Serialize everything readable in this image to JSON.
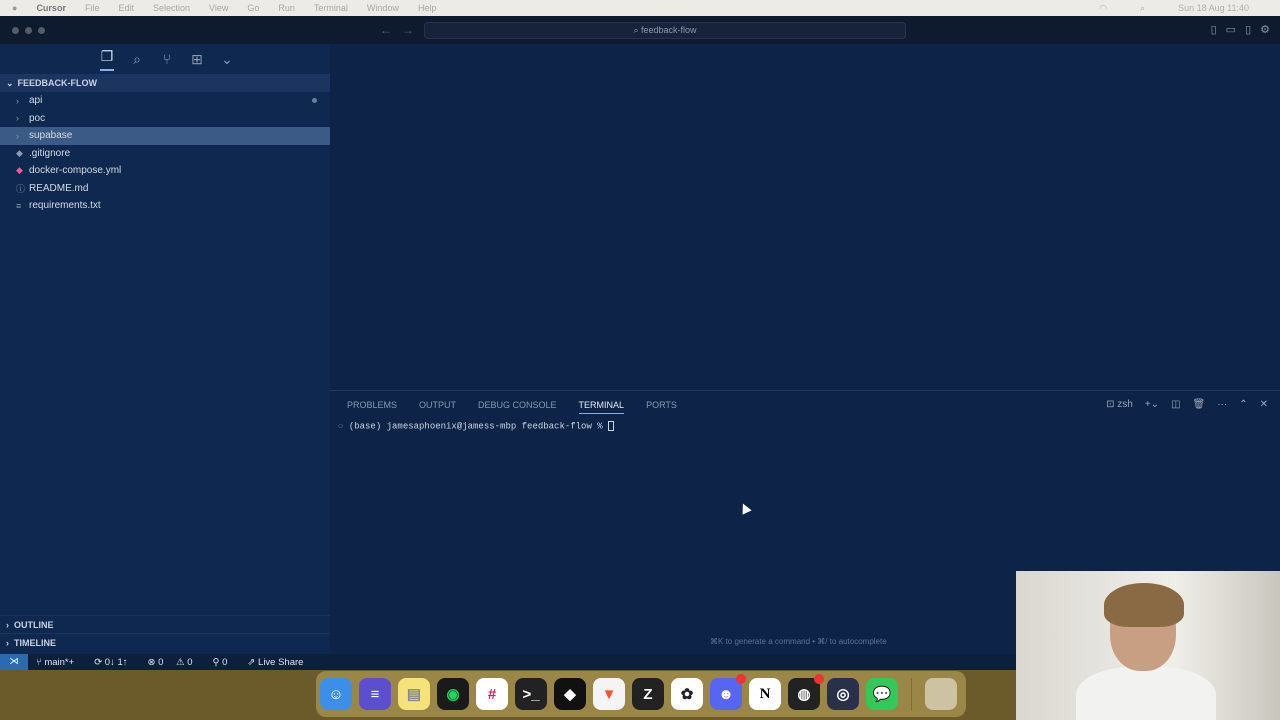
{
  "menubar": {
    "apple": "",
    "app": "Cursor",
    "items": [
      "File",
      "Edit",
      "Selection",
      "View",
      "Go",
      "Run",
      "Terminal",
      "Window",
      "Help"
    ],
    "clock": "Sun 18 Aug  11:40"
  },
  "titlebar": {
    "search": "⌕ feedback-flow"
  },
  "explorer": {
    "title": "FEEDBACK-FLOW",
    "items": [
      {
        "label": "api",
        "icon": "chevron-right",
        "modified": true
      },
      {
        "label": "poc",
        "icon": "chevron-right"
      },
      {
        "label": "supabase",
        "icon": "chevron-right",
        "selected": true
      },
      {
        "label": ".gitignore",
        "icon": "git-diamond"
      },
      {
        "label": "docker-compose.yml",
        "icon": "docker-whale"
      },
      {
        "label": "README.md",
        "icon": "info"
      },
      {
        "label": "requirements.txt",
        "icon": "lines"
      }
    ],
    "outline": "OUTLINE",
    "timeline": "TIMELINE"
  },
  "panel": {
    "tabs": [
      "PROBLEMS",
      "OUTPUT",
      "DEBUG CONSOLE",
      "TERMINAL",
      "PORTS"
    ],
    "active": "TERMINAL",
    "shell": "zsh",
    "prompt": "(base) jamesaphoenix@jamess-mbp feedback-flow % ",
    "hint": "⌘K to generate a command • ⌘/ to autocomplete"
  },
  "status": {
    "branch": "main*+",
    "sync": "0↓ 1↑",
    "errors": "0",
    "warnings": "0",
    "ports": "0",
    "liveshare": "Live Share"
  },
  "dock": [
    "finder",
    "linear-stack",
    "notes",
    "spotify",
    "slack",
    "terminal",
    "cursor",
    "brave",
    "zed",
    "chatgpt",
    "discord",
    "notion",
    "linear",
    "obs",
    "messages",
    "trash"
  ],
  "colors": {
    "editor": "#0d2448",
    "sidebar": "#0f2850",
    "accent": "#2a6bb0"
  }
}
